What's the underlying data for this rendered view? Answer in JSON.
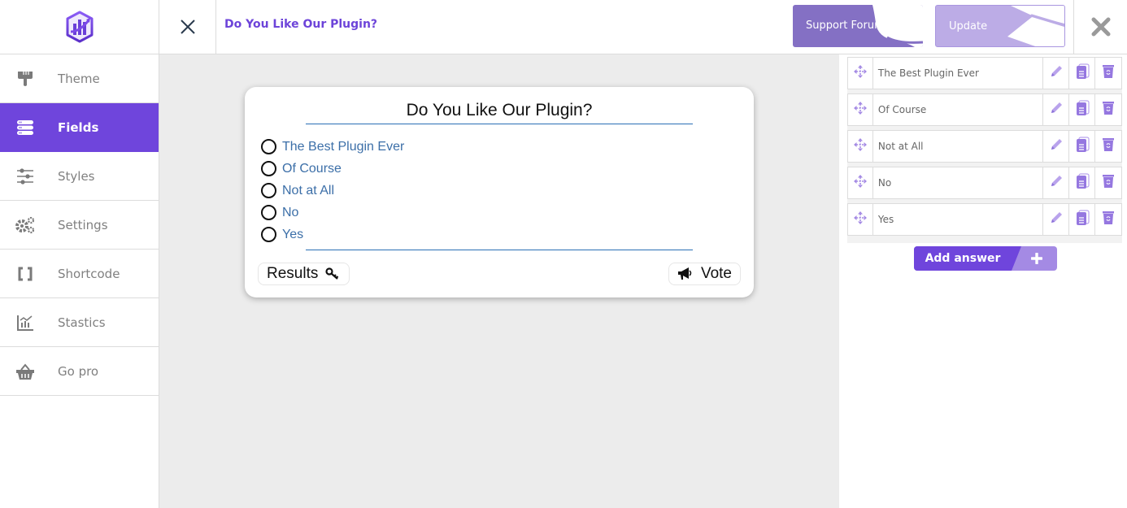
{
  "header": {
    "title": "Do You Like Our Plugin?",
    "support_button": "Support Forum",
    "update_button": "Update",
    "icons": {
      "logo": "chart-hexagon-logo",
      "close": "close-x-icon",
      "exit": "exit-x-icon"
    }
  },
  "sidebar": {
    "items": [
      {
        "label": "Theme",
        "icon": "paint-brush-icon",
        "active": false
      },
      {
        "label": "Fields",
        "icon": "database-list-icon",
        "active": true
      },
      {
        "label": "Styles",
        "icon": "sliders-icon",
        "active": false
      },
      {
        "label": "Settings",
        "icon": "gears-icon",
        "active": false
      },
      {
        "label": "Shortcode",
        "icon": "brackets-icon",
        "active": false
      },
      {
        "label": "Stastics",
        "icon": "chart-icon",
        "active": false
      },
      {
        "label": "Go pro",
        "icon": "basket-icon",
        "active": false
      }
    ]
  },
  "poll": {
    "question": "Do You Like Our Plugin?",
    "answers": [
      {
        "label": "The Best Plugin Ever",
        "selected": false
      },
      {
        "label": "Of Course",
        "selected": false
      },
      {
        "label": "Not at All",
        "selected": false
      },
      {
        "label": "No",
        "selected": false
      },
      {
        "label": "Yes",
        "selected": false
      }
    ],
    "results_button": "Results",
    "vote_button": "Vote"
  },
  "editor": {
    "answers": [
      "The Best Plugin Ever",
      "Of Course",
      "Not at All",
      "No",
      "Yes"
    ],
    "add_answer_label": "Add answer"
  },
  "colors": {
    "accent": "#6f45dc",
    "accent_light": "#a48ae4",
    "support_bg": "#8470c4",
    "update_bg": "#bcace6",
    "answer_text": "#3c6fa8",
    "divider": "#2a6fb5",
    "canvas_bg": "#ececec"
  }
}
